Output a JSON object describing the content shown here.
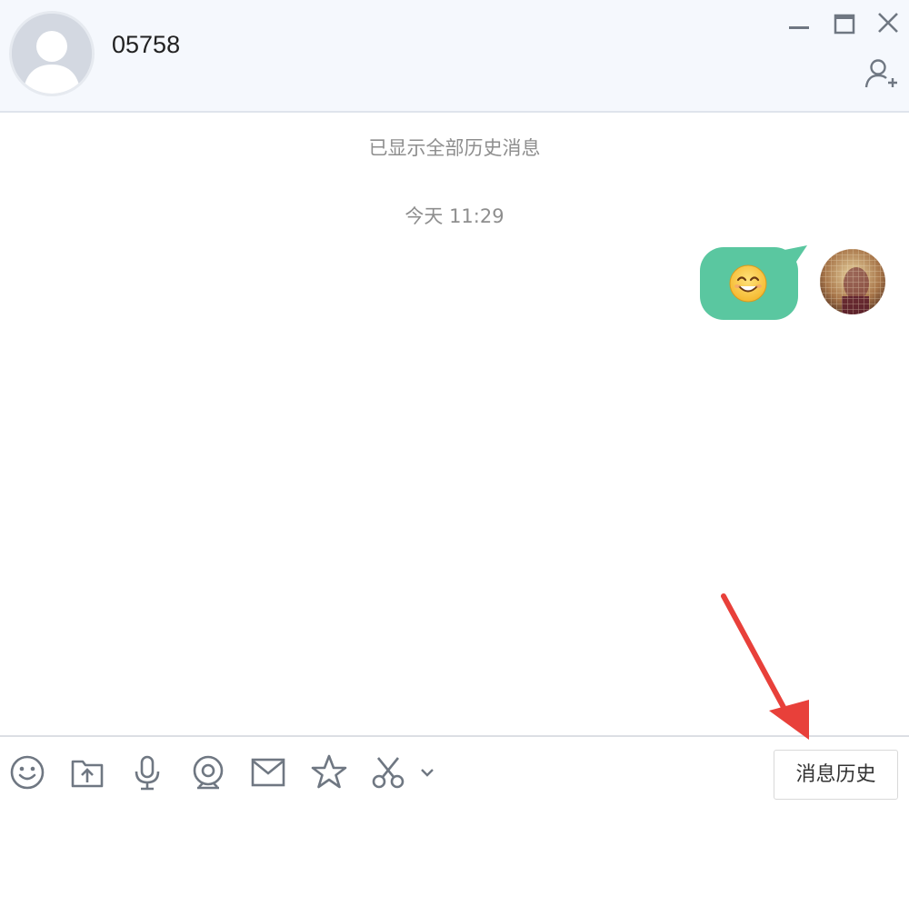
{
  "header": {
    "contact_name": "05758",
    "contact_avatar": "default-person-avatar",
    "window_controls": [
      "minimize-icon",
      "maximize-icon",
      "close-icon"
    ],
    "add_friend_icon": "add-user-icon"
  },
  "chat": {
    "history_notice": "已显示全部历史消息",
    "timestamp": "今天 11:29",
    "messages": [
      {
        "sender": "self",
        "content_type": "emoji",
        "emoji": "😊",
        "bubble_color": "#5ac7a0"
      }
    ]
  },
  "toolbar": {
    "icons": [
      "emoji-icon",
      "upload-file-icon",
      "microphone-icon",
      "webcam-icon",
      "mail-icon",
      "star-icon",
      "scissors-icon",
      "chevron-down-icon"
    ],
    "history_button_label": "消息历史"
  },
  "colors": {
    "accent": "#5ac7a0",
    "header_bg": "#f5f8fd",
    "annotation_arrow": "#e8403a",
    "icon_gray": "#6f7782"
  }
}
